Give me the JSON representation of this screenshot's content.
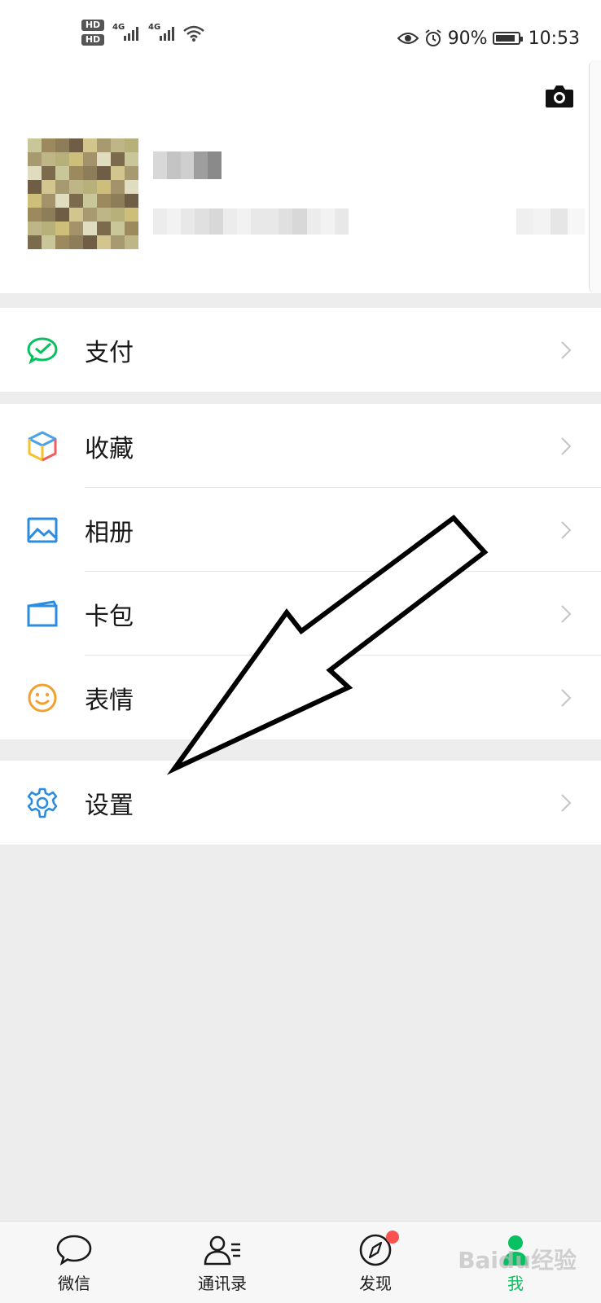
{
  "status_bar": {
    "hd1": "HD",
    "hd2": "HD",
    "net1": "4G",
    "net2": "4G",
    "battery_percent": "90%",
    "battery_level": 0.9,
    "time": "10:53"
  },
  "menu": {
    "pay": "支付",
    "favorites": "收藏",
    "album": "相册",
    "cards": "卡包",
    "stickers": "表情",
    "settings": "设置"
  },
  "tabs": [
    {
      "label": "微信",
      "icon": "chat-bubble-icon"
    },
    {
      "label": "通讯录",
      "icon": "contacts-icon"
    },
    {
      "label": "发现",
      "icon": "compass-icon"
    },
    {
      "label": "我",
      "icon": "me-icon"
    }
  ],
  "watermark": "Baidu经验",
  "colors": {
    "accent": "#07c160",
    "badge": "#fa5151"
  }
}
